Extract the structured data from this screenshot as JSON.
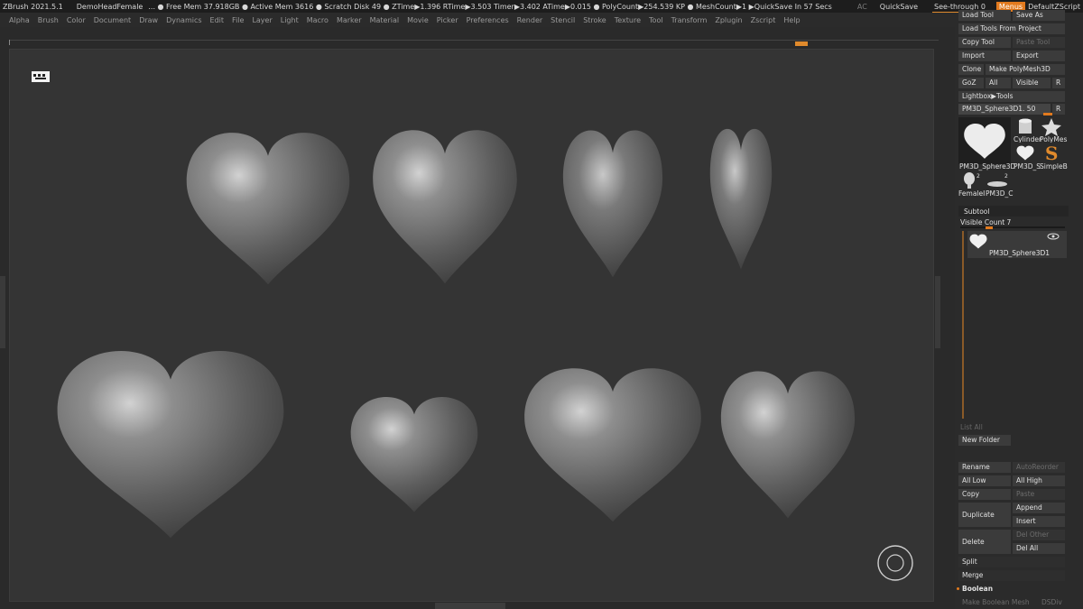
{
  "titlebar": {
    "app": "ZBrush 2021.5.1",
    "doc": "DemoHeadFemale",
    "stats": "... ● Free Mem 37.918GB ● Active Mem 3616 ● Scratch Disk 49 ●  ZTime▶1.396 RTime▶3.503 Timer▶3.402 ATime▶0.015 ● PolyCount▶254.539 KP ● MeshCount▶1  ▶QuickSave In 57 Secs",
    "ac": "AC",
    "quicksave": "QuickSave",
    "seethrough": "See-through  0",
    "menus": "Menus",
    "script": "DefaultZScript"
  },
  "menubar": [
    "Alpha",
    "Brush",
    "Color",
    "Document",
    "Draw",
    "Dynamics",
    "Edit",
    "File",
    "Layer",
    "Light",
    "Macro",
    "Marker",
    "Material",
    "Movie",
    "Picker",
    "Preferences",
    "Render",
    "Stencil",
    "Stroke",
    "Texture",
    "Tool",
    "Transform",
    "Zplugin",
    "Zscript",
    "Help"
  ],
  "tool_palette": {
    "load_tool": "Load Tool",
    "save_as": "Save As",
    "load_from_project": "Load Tools From Project",
    "copy_tool": "Copy Tool",
    "paste_tool": "Paste Tool",
    "import": "Import",
    "export": "Export",
    "clone": "Clone",
    "make_polymesh": "Make PolyMesh3D",
    "goz": "GoZ",
    "all": "All",
    "visible": "Visible",
    "r": "R",
    "lightbox_tools": "Lightbox▶Tools",
    "current_tool": "PM3D_Sphere3D1. 50",
    "current_r": "R",
    "thumbs": {
      "main": "PM3D_Sphere3D",
      "cylinder": "Cylinder",
      "polymesh": "PolyMes",
      "pm3d_s": "PM3D_S",
      "simpleb": "SimpleB",
      "female": "FemaleI",
      "pm3d_c": "PM3D_C",
      "count1": "2",
      "count2": "2"
    }
  },
  "subtool": {
    "header": "Subtool",
    "visible_count": "Visible Count  7",
    "item_name": "PM3D_Sphere3D1",
    "list_all": "List All",
    "new_folder": "New Folder",
    "rename": "Rename",
    "autoreorder": "AutoReorder",
    "all_low": "All Low",
    "all_high": "All High",
    "copy": "Copy",
    "paste": "Paste",
    "duplicate": "Duplicate",
    "append": "Append",
    "insert": "Insert",
    "del_other": "Del Other",
    "delete": "Delete",
    "del_all": "Del All",
    "split": "Split",
    "merge": "Merge",
    "boolean": "Boolean",
    "make_boolean_mesh": "Make Boolean Mesh",
    "dsdiv": "DSDiv"
  },
  "colors": {
    "accent": "#e27a1e",
    "canvas": "#343434",
    "panel": "#2b2b2b",
    "button": "#3b3b3b"
  }
}
